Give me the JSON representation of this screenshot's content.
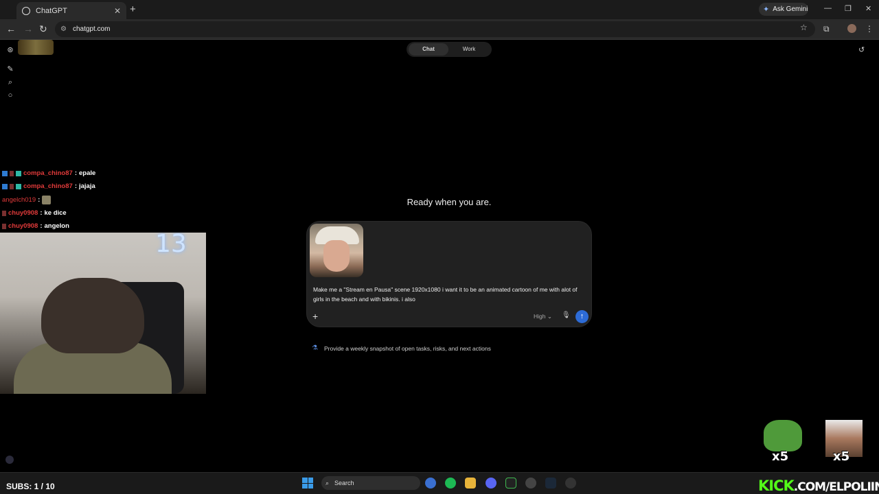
{
  "browser": {
    "tab_title": "ChatGPT",
    "gemini_label": "Ask Gemini",
    "url": "chatgpt.com"
  },
  "toggle": {
    "chat_label": "Chat",
    "work_label": "Work"
  },
  "main": {
    "heading": "Ready when you are.",
    "prompt_text": "Make me a \"Stream en Pausa\" scene 1920x1080 i want it to be an animated cartoon of me with alot of girls in the beach and with bikinis. i also",
    "effort_label": "High",
    "suggestion": "Provide a weekly snapshot of open tasks, risks, and next actions"
  },
  "stream_chat": [
    {
      "user": "compa_chino87",
      "message": "epale"
    },
    {
      "user": "compa_chino87",
      "message": "jajaja"
    },
    {
      "user": "angelch019",
      "message": ""
    },
    {
      "user": "chuy0908",
      "message": "ke dice"
    },
    {
      "user": "chuy0908",
      "message": "angelon"
    }
  ],
  "overlay": {
    "webcam_number": "13",
    "multiplier_1": "x5",
    "multiplier_2": "x5",
    "subs": "SUBS: 1 / 10",
    "kick_brand": "KICK",
    "kick_domain": ".COM/ELPOLIIN"
  },
  "taskbar": {
    "search_label": "Search"
  },
  "colors": {
    "send_button": "#2d6bd6",
    "kick_green": "#53fc18",
    "chat_username": "#e03a3a"
  }
}
